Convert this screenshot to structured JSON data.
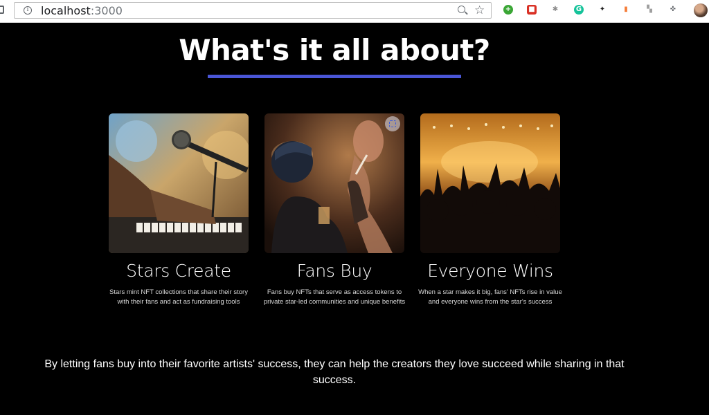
{
  "browser": {
    "url_host": "localhost",
    "url_port": ":3000",
    "extensions": [
      {
        "name": "plus-extension-icon",
        "glyph": "+",
        "color": "#3aa635"
      },
      {
        "name": "red-extension-icon",
        "glyph": "■",
        "color": "#d93025"
      },
      {
        "name": "bug-extension-icon",
        "glyph": "✱",
        "color": "#8a8a8a"
      },
      {
        "name": "grammarly-extension-icon",
        "glyph": "G",
        "color": "#15c39a"
      },
      {
        "name": "paw-extension-icon",
        "glyph": "✦",
        "color": "#222222"
      },
      {
        "name": "orange-extension-icon",
        "glyph": "▮",
        "color": "#f57c38"
      },
      {
        "name": "gray-extension-icon",
        "glyph": "▚",
        "color": "#9e9e9e"
      },
      {
        "name": "puzzle-extension-icon",
        "glyph": "✜",
        "color": "#5f6368"
      }
    ]
  },
  "page": {
    "title": "What's it all about?",
    "accent_color": "#4a56d6",
    "cards": [
      {
        "heading": "Stars Create",
        "text": "Stars mint NFT collections that share their story with their fans and act as fundraising tools",
        "image": "pianist-with-microphone"
      },
      {
        "heading": "Fans Buy",
        "text": "Fans buy NFTs that serve as access tokens to private star-led communities and unique benefits",
        "image": "fan-watching-performer"
      },
      {
        "heading": "Everyone Wins",
        "text": "When a star makes it big, fans' NFTs rise in value and everyone wins from the star's success",
        "image": "concert-crowd"
      }
    ],
    "tagline": "By letting fans buy into their favorite artists' success, they can help the creators they love succeed while sharing in that success."
  }
}
